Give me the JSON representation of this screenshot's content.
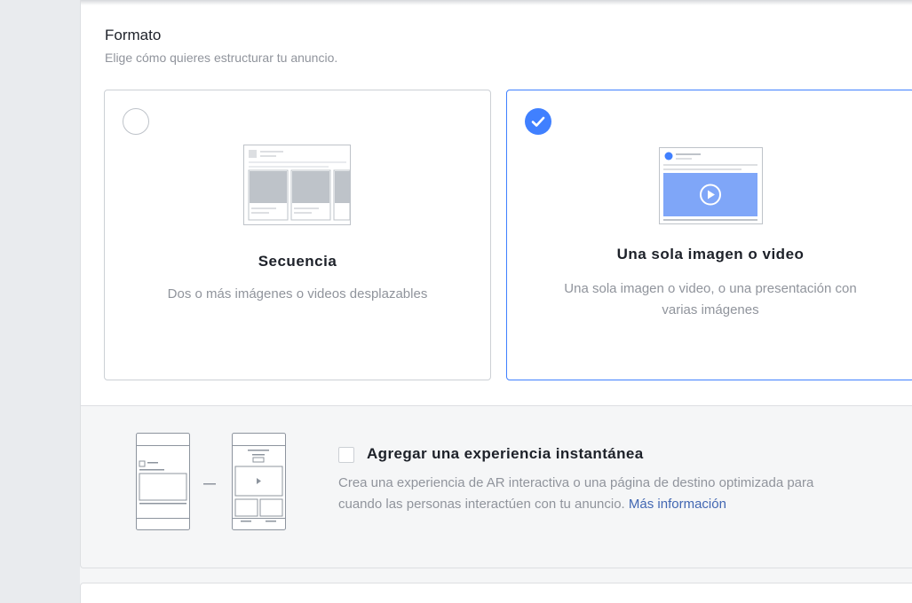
{
  "format": {
    "title": "Formato",
    "subtitle": "Elige cómo quieres estructurar tu anuncio.",
    "options": [
      {
        "label": "Secuencia",
        "description": "Dos o más imágenes o videos desplazables",
        "selected": false
      },
      {
        "label": "Una sola imagen o video",
        "description_line1": "Una sola imagen o video, o una presentación con",
        "description_line2": "varias imágenes",
        "selected": true
      }
    ]
  },
  "instant_experience": {
    "checkbox_label": "Agregar una experiencia instantánea",
    "description_line1": "Crea una experiencia de AR interactiva o una página de destino optimizada para",
    "description_line2": "cuando las personas interactúen con tu anuncio.",
    "link_text": "Más información",
    "checked": false
  },
  "colors": {
    "accent": "#4080ff",
    "link": "#4267b2",
    "muted_text": "#90949c",
    "primary_text": "#1d2129"
  }
}
